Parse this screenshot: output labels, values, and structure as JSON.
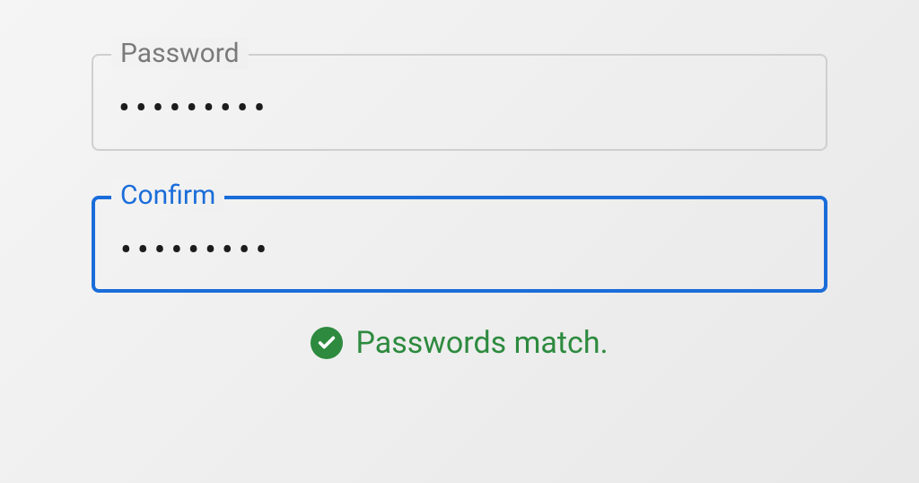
{
  "fields": {
    "password": {
      "label": "Password",
      "value": "•••••••••"
    },
    "confirm": {
      "label": "Confirm",
      "value": "•••••••••"
    }
  },
  "status": {
    "message": "Passwords match.",
    "icon": "checkmark-circle",
    "color": "#2d8a3e"
  },
  "colors": {
    "accent": "#1a6dd9",
    "inactiveBorder": "#cfcfcf",
    "labelInactive": "#7a7a7a",
    "success": "#2d8a3e"
  }
}
